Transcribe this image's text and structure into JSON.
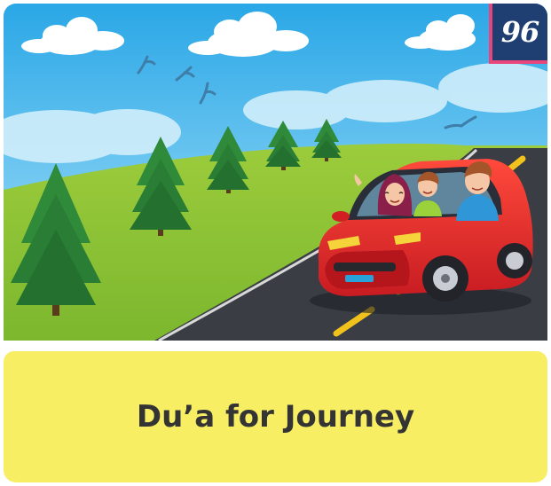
{
  "card": {
    "badge_number": "96",
    "title": "Du’a for Journey",
    "illustration_icon": "family-car-journey-illustration"
  },
  "colors": {
    "badge_bg": "#1f3f73",
    "badge_border": "#e8457a",
    "title_panel_bg": "#f8ee64",
    "title_text": "#343434",
    "car_red": "#e8262b"
  }
}
